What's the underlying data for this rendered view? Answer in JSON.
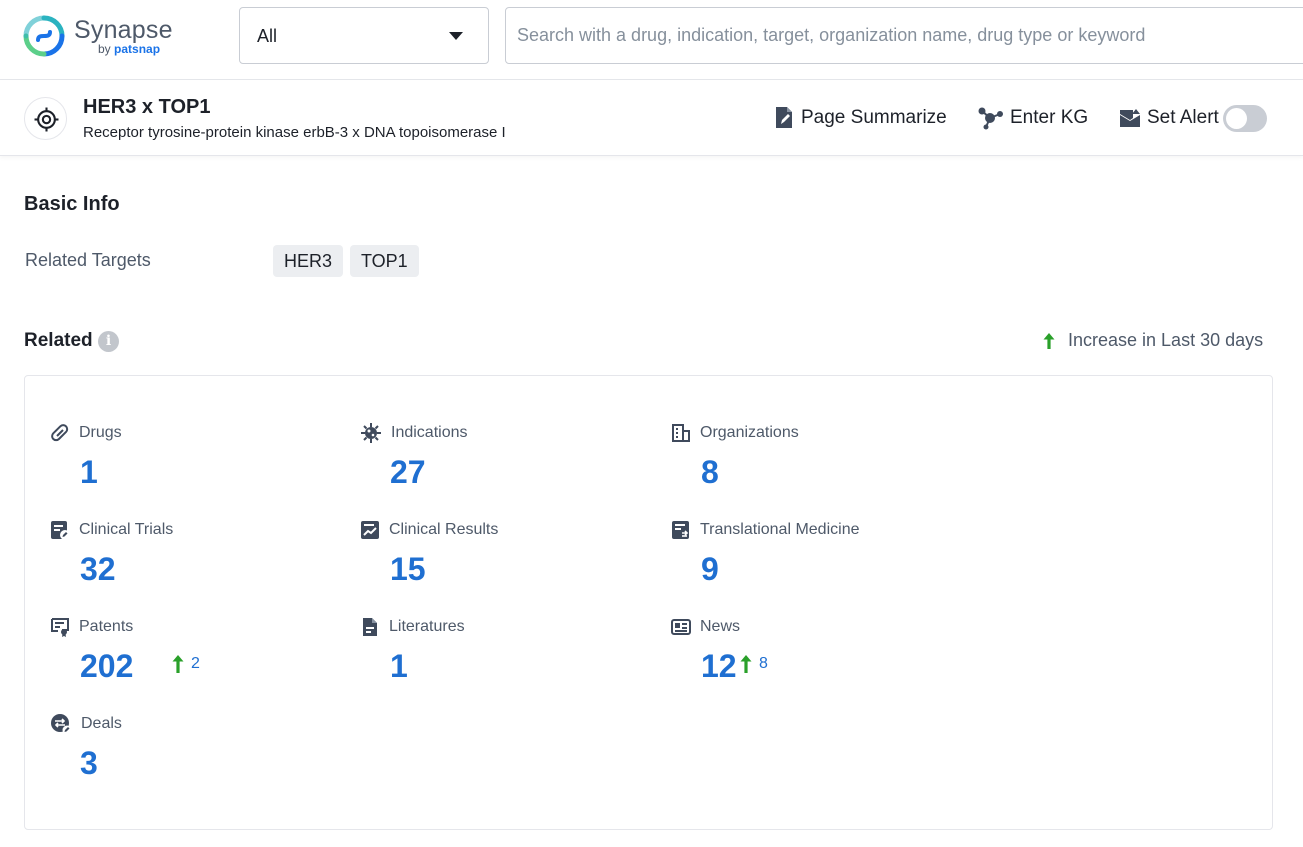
{
  "app": {
    "logo_name": "Synapse",
    "logo_by": "by",
    "logo_brand": "patsnap"
  },
  "search": {
    "scope_value": "All",
    "placeholder": "Search with a drug, indication, target, organization name, drug type or keyword",
    "value": ""
  },
  "entity": {
    "title": "HER3 x TOP1",
    "subtitle": "Receptor tyrosine-protein kinase erbB-3 x DNA topoisomerase I"
  },
  "actions": {
    "summarize_label": "Page Summarize",
    "kg_label": "Enter KG",
    "alert_label": "Set Alert",
    "alert_enabled": false
  },
  "basic_info": {
    "title": "Basic Info",
    "related_targets_label": "Related Targets",
    "related_targets": [
      "HER3",
      "TOP1"
    ]
  },
  "related": {
    "title": "Related",
    "increase_legend": "Increase in Last 30 days",
    "stats": {
      "drugs": {
        "label": "Drugs",
        "value": "1"
      },
      "indications": {
        "label": "Indications",
        "value": "27"
      },
      "organizations": {
        "label": "Organizations",
        "value": "8"
      },
      "clinical_trials": {
        "label": "Clinical Trials",
        "value": "32"
      },
      "clinical_results": {
        "label": "Clinical Results",
        "value": "15"
      },
      "translational_medicine": {
        "label": "Translational Medicine",
        "value": "9"
      },
      "patents": {
        "label": "Patents",
        "value": "202",
        "increase": "2"
      },
      "literatures": {
        "label": "Literatures",
        "value": "1"
      },
      "news": {
        "label": "News",
        "value": "12",
        "increase": "8"
      },
      "deals": {
        "label": "Deals",
        "value": "3"
      }
    }
  },
  "colors": {
    "accent_blue": "#1f6fd1",
    "increase_green": "#2aa02a",
    "icon_gray": "#4e5969"
  }
}
